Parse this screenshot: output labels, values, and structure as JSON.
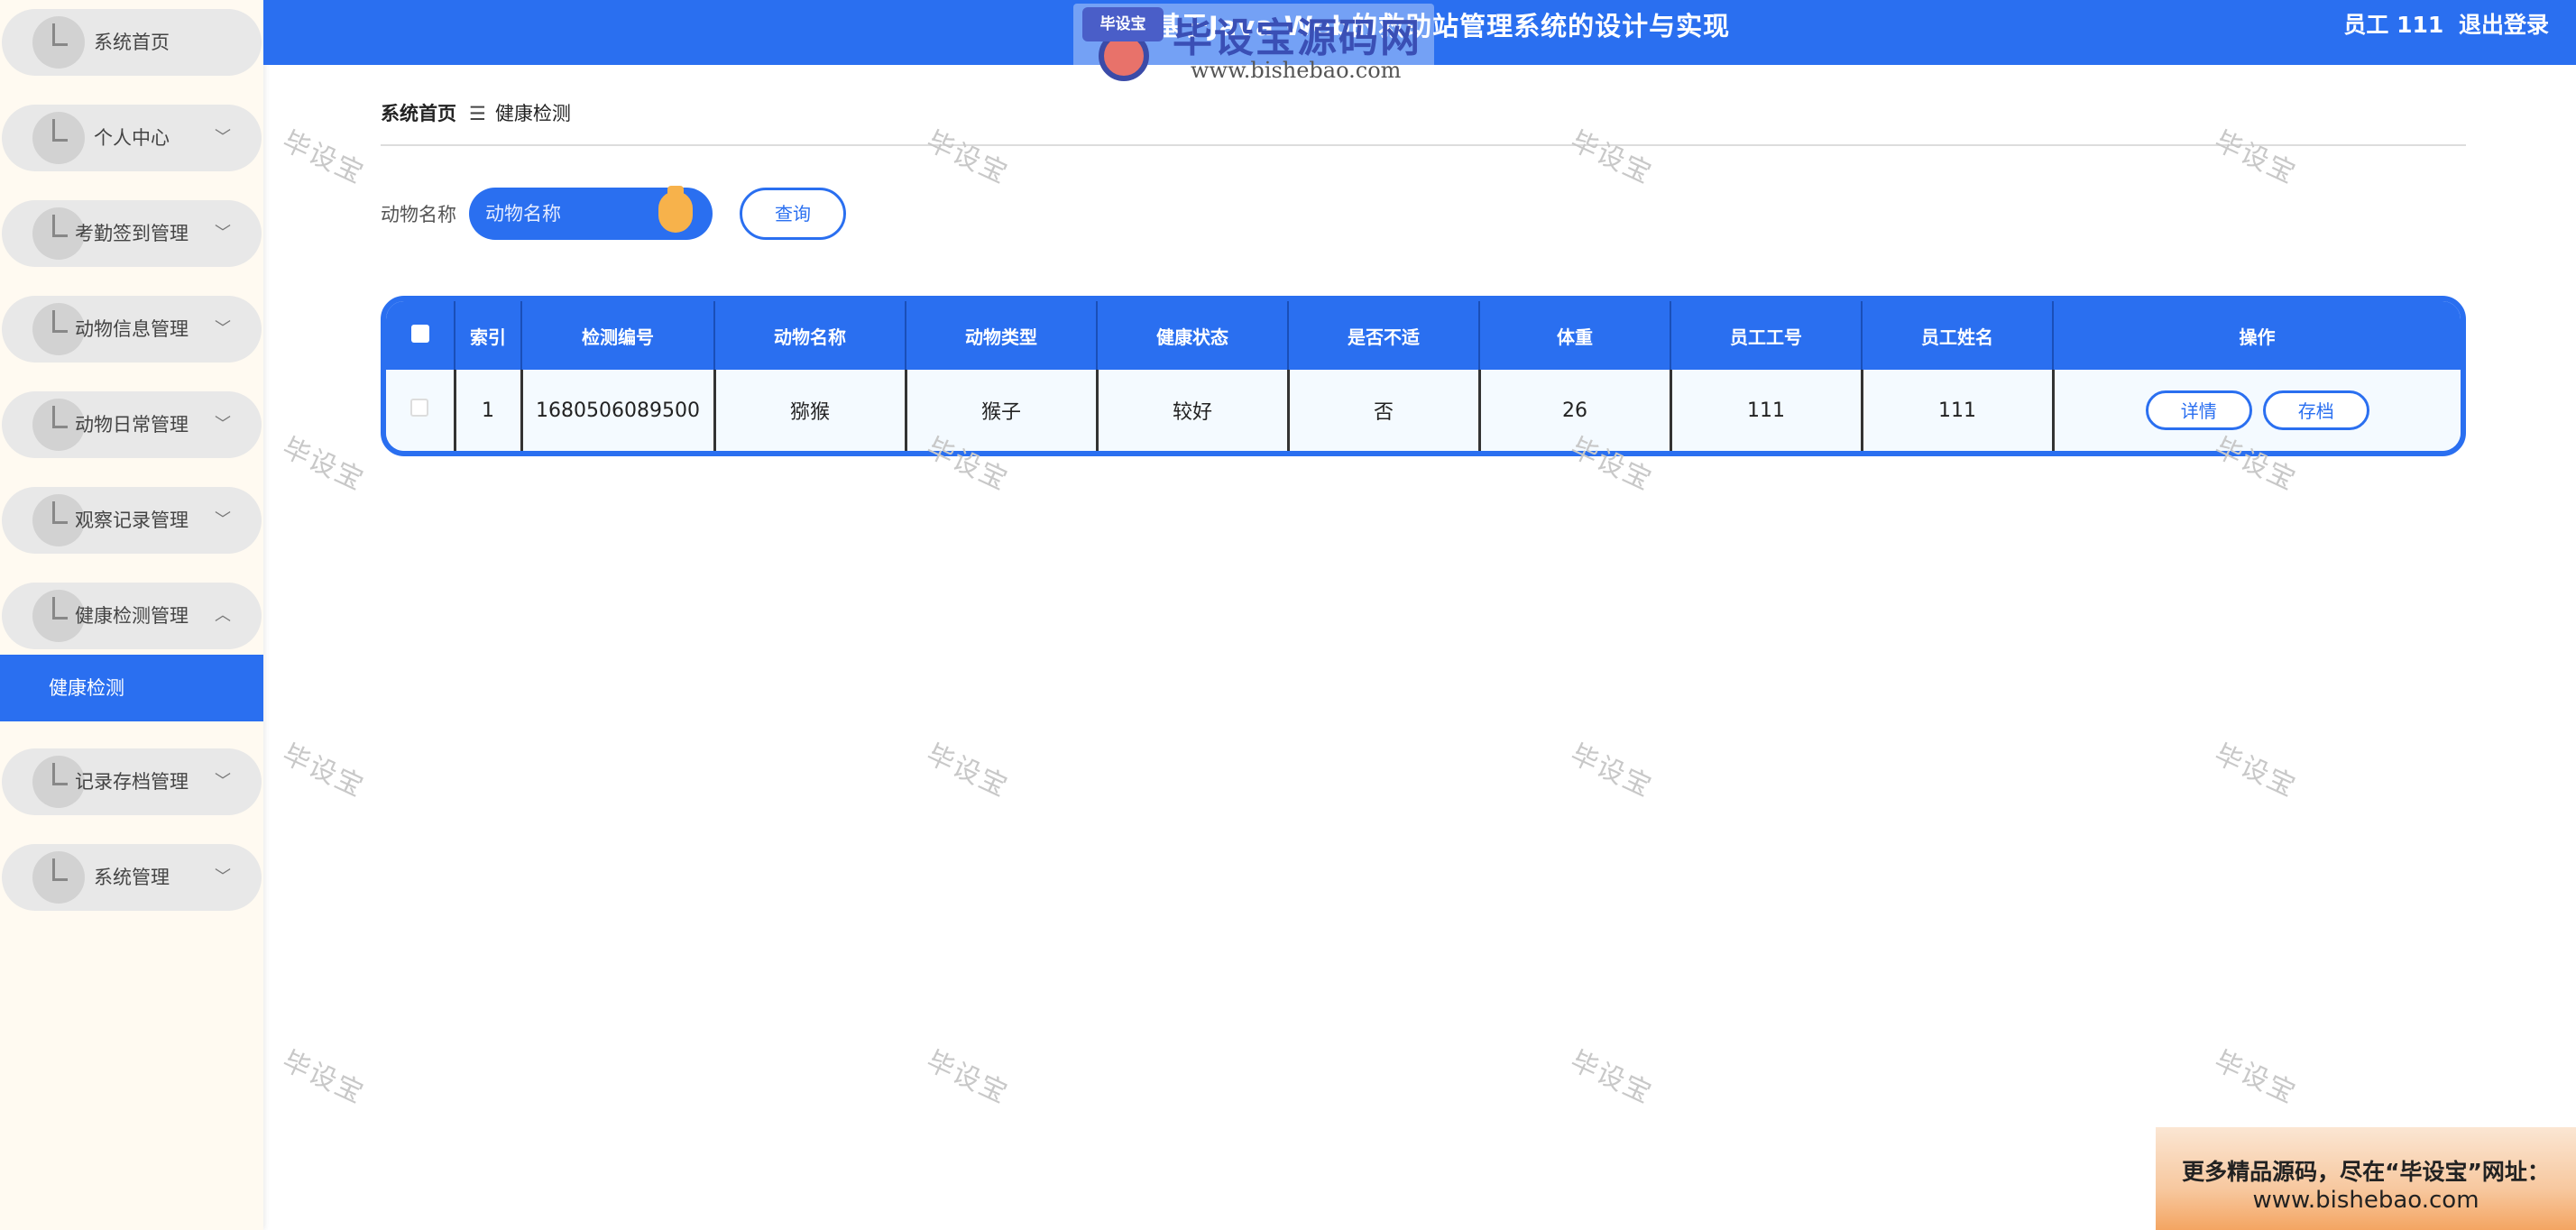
{
  "app": {
    "title": "基于Java Web的救助站管理系统的设计与实现",
    "user_label": "员工 111",
    "logout": "退出登录"
  },
  "logo": {
    "badge": "毕设宝",
    "text": "毕设宝源码网",
    "url": "www.bishebao.com"
  },
  "sidebar": {
    "items": [
      {
        "label": "系统首页",
        "arrow": ""
      },
      {
        "label": "个人中心",
        "arrow": "﹀"
      },
      {
        "label": "考勤签到管理",
        "arrow": "﹀"
      },
      {
        "label": "动物信息管理",
        "arrow": "﹀"
      },
      {
        "label": "动物日常管理",
        "arrow": "﹀"
      },
      {
        "label": "观察记录管理",
        "arrow": "﹀"
      },
      {
        "label": "健康检测管理",
        "arrow": "︿"
      },
      {
        "label": "记录存档管理",
        "arrow": "﹀"
      },
      {
        "label": "系统管理",
        "arrow": "﹀"
      }
    ],
    "active_sub": "健康检测"
  },
  "breadcrumb": {
    "home": "系统首页",
    "sep": "☰",
    "current": "健康检测"
  },
  "search": {
    "label": "动物名称",
    "placeholder": "动物名称",
    "query_btn": "查询"
  },
  "table": {
    "headers": [
      "索引",
      "检测编号",
      "动物名称",
      "动物类型",
      "健康状态",
      "是否不适",
      "体重",
      "员工工号",
      "员工姓名",
      "操作"
    ],
    "rows": [
      {
        "index": "1",
        "code": "1680506089500",
        "name": "猕猴",
        "type": "猴子",
        "health": "较好",
        "discomfort": "否",
        "weight": "26",
        "emp_no": "111",
        "emp_name": "111",
        "actions": [
          "详情",
          "存档"
        ]
      }
    ]
  },
  "watermark": "毕设宝",
  "promo": {
    "line1": "更多精品源码，尽在“毕设宝”网址：",
    "line2": "www.bishebao.com"
  },
  "colors": {
    "primary": "#2a6ff0",
    "sidebar_bg": "#fffaf1",
    "accent_orange": "#f7b24b"
  }
}
